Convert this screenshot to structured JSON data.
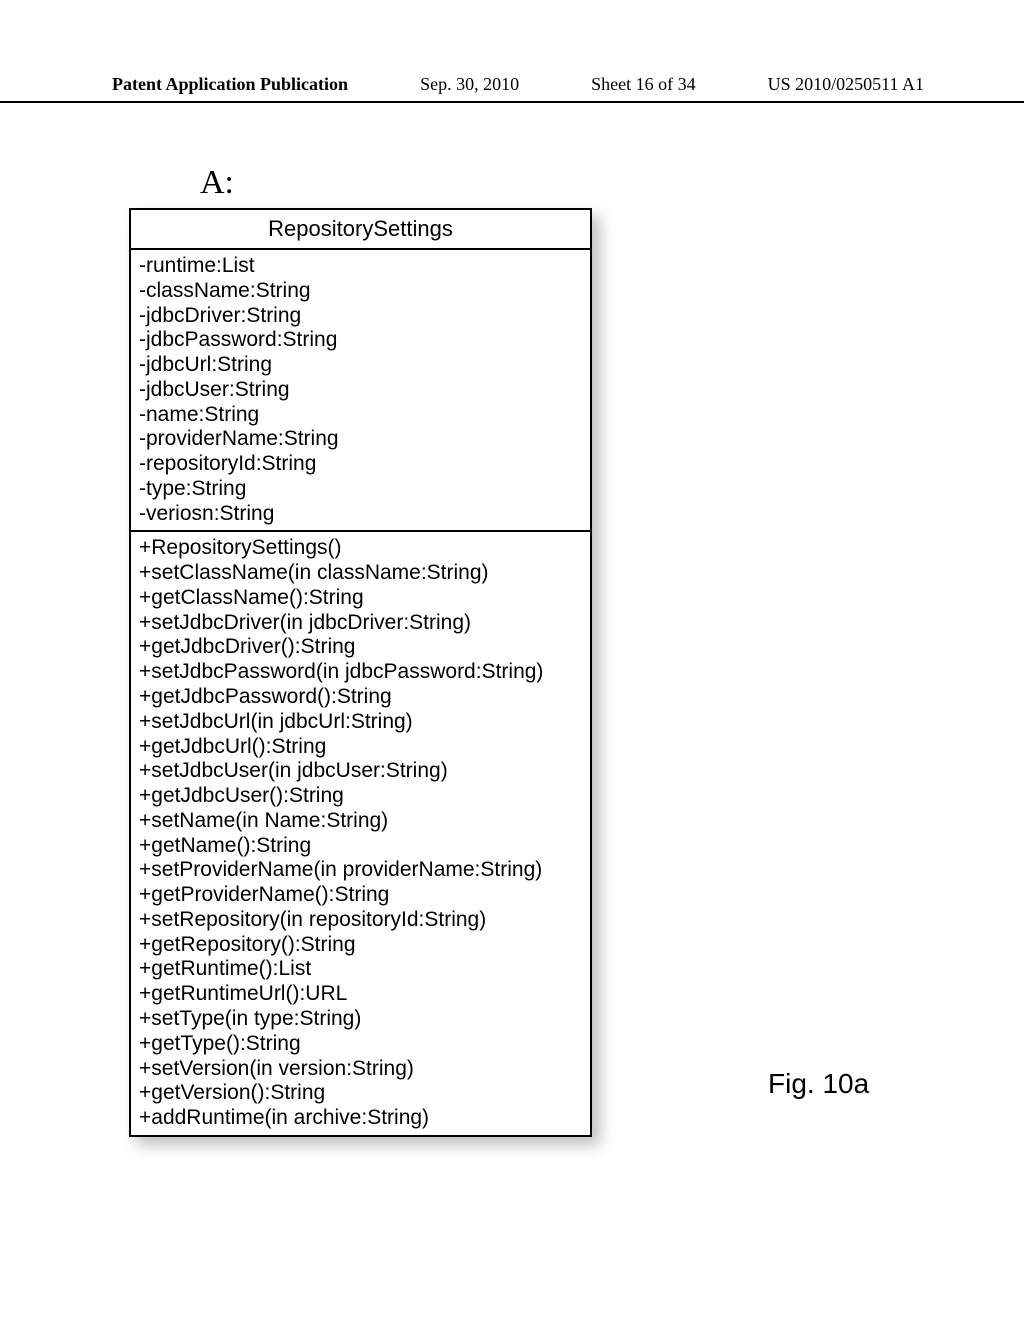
{
  "header": {
    "left": "Patent Application Publication",
    "date": "Sep. 30, 2010",
    "sheet": "Sheet 16 of 34",
    "id": "US 2010/0250511 A1"
  },
  "labelA": "A:",
  "figLabel": "Fig. 10a",
  "uml": {
    "name": "RepositorySettings",
    "attributes": [
      "-runtime:List",
      "-className:String",
      "-jdbcDriver:String",
      "-jdbcPassword:String",
      "-jdbcUrl:String",
      "-jdbcUser:String",
      "-name:String",
      "-providerName:String",
      "-repositoryId:String",
      "-type:String",
      "-veriosn:String"
    ],
    "operations": [
      "+RepositorySettings()",
      "+setClassName(in className:String)",
      "+getClassName():String",
      "+setJdbcDriver(in jdbcDriver:String)",
      "+getJdbcDriver():String",
      "+setJdbcPassword(in jdbcPassword:String)",
      "+getJdbcPassword():String",
      "+setJdbcUrl(in jdbcUrl:String)",
      "+getJdbcUrl():String",
      "+setJdbcUser(in jdbcUser:String)",
      "+getJdbcUser():String",
      "+setName(in Name:String)",
      "+getName():String",
      "+setProviderName(in providerName:String)",
      "+getProviderName():String",
      "+setRepository(in repositoryId:String)",
      "+getRepository():String",
      "+getRuntime():List",
      "+getRuntimeUrl():URL",
      "+setType(in type:String)",
      "+getType():String",
      "+setVersion(in version:String)",
      "+getVersion():String",
      "+addRuntime(in archive:String)"
    ]
  }
}
